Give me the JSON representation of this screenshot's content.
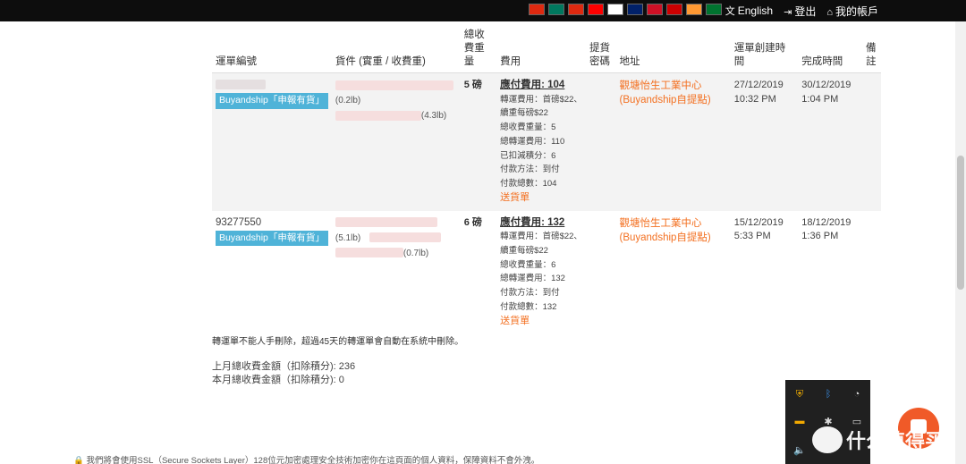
{
  "topbar": {
    "flags": [
      {
        "name": "hong-kong-flag",
        "color": "#de2910"
      },
      {
        "name": "macau-flag",
        "color": "#00785e"
      },
      {
        "name": "china-flag",
        "color": "#de2910"
      },
      {
        "name": "taiwan-flag",
        "color": "#fe0000"
      },
      {
        "name": "japan-flag",
        "color": "#ffffff"
      },
      {
        "name": "australia-flag",
        "color": "#012169"
      },
      {
        "name": "indonesia-flag",
        "color": "#ce1126"
      },
      {
        "name": "malaysia-flag",
        "color": "#cc0001"
      },
      {
        "name": "india-flag",
        "color": "#ff9933"
      },
      {
        "name": "uae-flag",
        "color": "#00732f"
      }
    ],
    "language_label": "English",
    "logout_label": "登出",
    "account_label": "我的帳戶"
  },
  "table": {
    "headers": {
      "waybill": "運單編號",
      "goods": "貨件 (實重 / 收費重)",
      "weight": "總收費重量",
      "fee": "費用",
      "pickup_code": "提貨密碼",
      "address": "地址",
      "created": "運單創建時間",
      "completed": "完成時間",
      "remarks": "備註"
    },
    "rows": [
      {
        "waybill_no": "",
        "tag": "Buyandship「申報有貨」",
        "goods": [
          {
            "weight": "(0.2lb)"
          },
          {
            "weight": "(4.3lb)"
          }
        ],
        "charge_weight": "5 磅",
        "fee_title": "應付費用: 104",
        "fee_lines": [
          "轉運費用：首磅$22、",
          "續重每磅$22",
          "總收費重量：5",
          "總轉運費用：110",
          "已扣減積分：6",
          "付款方法：到付",
          "付款總數：104"
        ],
        "delivery_note_link": "送貨單",
        "address_line1": "觀塘怡生工業中心",
        "address_line2": "(Buyandship自提點)",
        "created_date": "27/12/2019",
        "created_time": "10:32 PM",
        "completed_date": "30/12/2019",
        "completed_time": "1:04 PM"
      },
      {
        "waybill_no": "93277550",
        "tag": "Buyandship「申報有貨」",
        "goods": [
          {
            "weight": "(5.1lb)"
          },
          {
            "weight": "(0.7lb)"
          }
        ],
        "charge_weight": "6 磅",
        "fee_title": "應付費用: 132",
        "fee_lines": [
          "轉運費用：首磅$22、",
          "續重每磅$22",
          "總收費重量：6",
          "總轉運費用：132",
          "付款方法：到付",
          "付款總數：132"
        ],
        "delivery_note_link": "送貨單",
        "address_line1": "觀塘怡生工業中心",
        "address_line2": "(Buyandship自提點)",
        "created_date": "15/12/2019",
        "created_time": "5:33 PM",
        "completed_date": "18/12/2019",
        "completed_time": "1:36 PM"
      }
    ]
  },
  "note": "轉運單不能人手刪除，超過45天的轉運單會自動在系統中刪除。",
  "summary": {
    "last_month": "上月總收費金額（扣除積分): 236",
    "this_month": "本月總收費金額（扣除積分): 0"
  },
  "ssl_notice": "我們將會使用SSL（Secure Sockets Layer）128位元加密處理安全技術加密你在這頁面的個人資料，保障資料不會外洩。",
  "tray": {
    "icons": [
      "shield-icon",
      "bluetooth-icon",
      "wifi-icon",
      "folder-icon",
      "network-icon",
      "battery-icon",
      "volume-icon"
    ]
  },
  "watermark": "什么值得买",
  "colors": {
    "accent": "#f37021",
    "tag": "#4fb3d8",
    "topbar": "#0d0d0d"
  }
}
